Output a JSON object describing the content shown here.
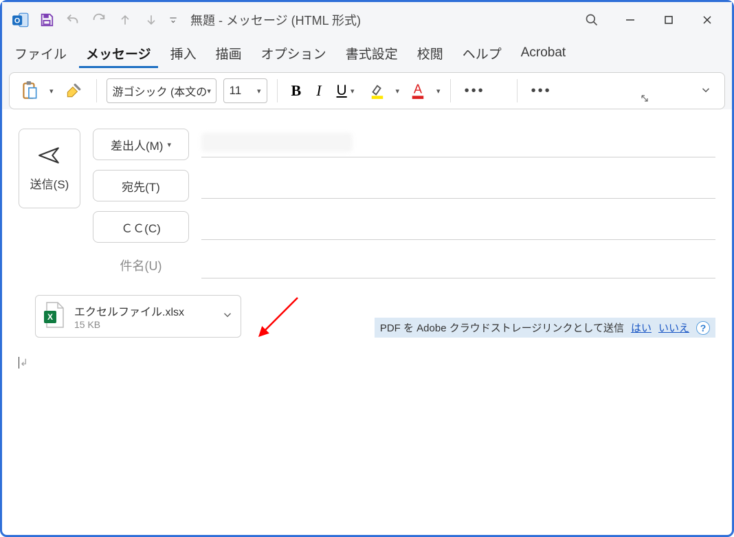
{
  "title": "無題   -   メッセージ (HTML 形式)",
  "tabs": {
    "file": "ファイル",
    "message": "メッセージ",
    "insert": "挿入",
    "draw": "描画",
    "options": "オプション",
    "format": "書式設定",
    "review": "校閲",
    "help": "ヘルプ",
    "acrobat": "Acrobat"
  },
  "ribbon": {
    "font_name": "游ゴシック (本文の",
    "font_size": "11"
  },
  "compose": {
    "send": "送信(S)",
    "from": "差出人(M)",
    "to": "宛先(T)",
    "cc": "ＣＣ(C)",
    "subject": "件名(U)"
  },
  "attachment": {
    "filename": "エクセルファイル.xlsx",
    "size": "15 KB"
  },
  "adobe": {
    "text": "PDF を Adobe クラウドストレージリンクとして送信",
    "yes": "はい",
    "no": "いいえ"
  }
}
